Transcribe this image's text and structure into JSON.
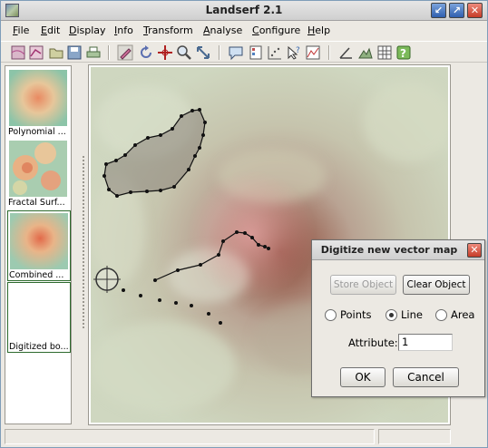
{
  "window": {
    "title": "Landserf 2.1"
  },
  "menu": [
    {
      "label": "File",
      "ul": "F",
      "rest": "ile"
    },
    {
      "label": "Edit",
      "ul": "E",
      "rest": "dit"
    },
    {
      "label": "Display",
      "ul": "D",
      "rest": "isplay"
    },
    {
      "label": "Info",
      "ul": "I",
      "rest": "nfo"
    },
    {
      "label": "Transform",
      "ul": "T",
      "rest": "ransform"
    },
    {
      "label": "Analyse",
      "ul": "A",
      "rest": "nalyse"
    },
    {
      "label": "Configure",
      "ul": "C",
      "rest": "onfigure"
    },
    {
      "label": "Help",
      "ul": "H",
      "rest": "elp"
    }
  ],
  "toolbar": [
    {
      "icon": "new-raster-icon"
    },
    {
      "icon": "new-vector-icon"
    },
    {
      "icon": "open-folder-icon"
    },
    {
      "icon": "save-icon"
    },
    {
      "icon": "print-icon"
    },
    {
      "icon": "edit-pencil-icon"
    },
    {
      "icon": "refresh-icon"
    },
    {
      "icon": "crosshair-icon"
    },
    {
      "icon": "zoom-icon"
    },
    {
      "icon": "pan-icon"
    },
    {
      "icon": "info-bubble-icon"
    },
    {
      "icon": "legend-icon"
    },
    {
      "icon": "scatter-icon"
    },
    {
      "icon": "query-icon"
    },
    {
      "icon": "graph-icon"
    },
    {
      "icon": "angle-icon"
    },
    {
      "icon": "palette-icon"
    },
    {
      "icon": "grid-icon"
    },
    {
      "icon": "help-icon"
    }
  ],
  "thumbnails": [
    {
      "caption": "Polynomial ..."
    },
    {
      "caption": "Fractal Surf..."
    },
    {
      "caption": "Combined ..."
    },
    {
      "caption": "Digitized bo..."
    }
  ],
  "dialog": {
    "title": "Digitize new vector map",
    "store_label": "Store Object",
    "clear_label": "Clear Object",
    "radio_points": "Points",
    "radio_line": "Line",
    "radio_area": "Area",
    "selected_type": "Line",
    "attribute_label": "Attribute:",
    "attribute_value": "1",
    "ok_label": "OK",
    "cancel_label": "Cancel"
  },
  "colors": {
    "map_low": "#c9d2b8",
    "map_mid": "#b7a998",
    "map_peak": "#8a4a3a",
    "polygon_fill": "#8a847a"
  }
}
